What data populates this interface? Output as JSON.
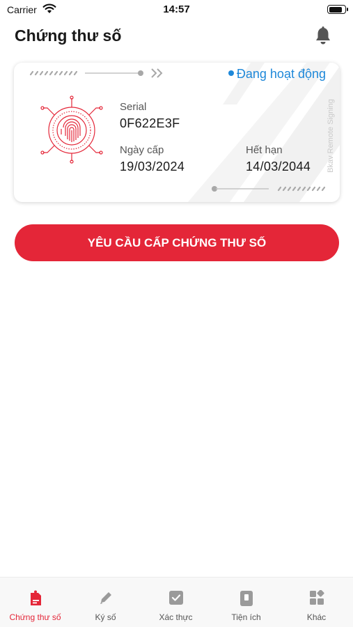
{
  "status_bar": {
    "carrier": "Carrier",
    "time": "14:57",
    "battery_level": 0.9
  },
  "header": {
    "title": "Chứng thư số"
  },
  "certificate": {
    "status": "Đang hoạt động",
    "status_color": "#1e88d9",
    "side_text": "Bkav Remote Signing",
    "serial_label": "Serial",
    "serial_value": "0F622E3F",
    "issue_label": "Ngày cấp",
    "issue_date": "19/03/2024",
    "expiry_label": "Hết hạn",
    "expiry_date": "14/03/2044"
  },
  "request_button": {
    "label": "YÊU CẦU CẤP CHỨNG THƯ SỐ",
    "color": "#e42638"
  },
  "tabs": [
    {
      "label": "Chứng thư số",
      "icon": "certificate-icon",
      "active": true
    },
    {
      "label": "Ký số",
      "icon": "pen-icon",
      "active": false
    },
    {
      "label": "Xác thực",
      "icon": "check-icon",
      "active": false
    },
    {
      "label": "Tiện ích",
      "icon": "device-icon",
      "active": false
    },
    {
      "label": "Khác",
      "icon": "grid-icon",
      "active": false
    }
  ]
}
